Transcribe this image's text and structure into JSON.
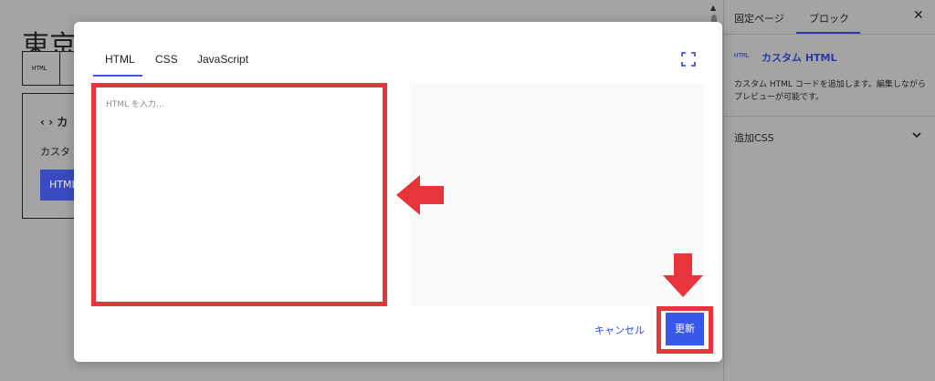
{
  "background_editor": {
    "page_title": "東京",
    "toolbar_label": "HTML",
    "block_heading": "‹ › カ",
    "block_text": "カスタ",
    "block_button": "HTML"
  },
  "sidebar": {
    "tabs": [
      "固定ページ",
      "ブロック"
    ],
    "close_label": "✕",
    "block_icon": "HTML",
    "block_title": "カスタム HTML",
    "block_description": "カスタム HTML コードを追加します。編集しながらプレビューが可能です。",
    "additional_css": "追加CSS"
  },
  "modal": {
    "tabs": [
      "HTML",
      "CSS",
      "JavaScript"
    ],
    "active_tab": "HTML",
    "editor_placeholder": "HTML を入力…",
    "cancel_label": "キャンセル",
    "update_label": "更新"
  },
  "colors": {
    "accent": "#3858e9",
    "highlight": "#e8353b"
  }
}
